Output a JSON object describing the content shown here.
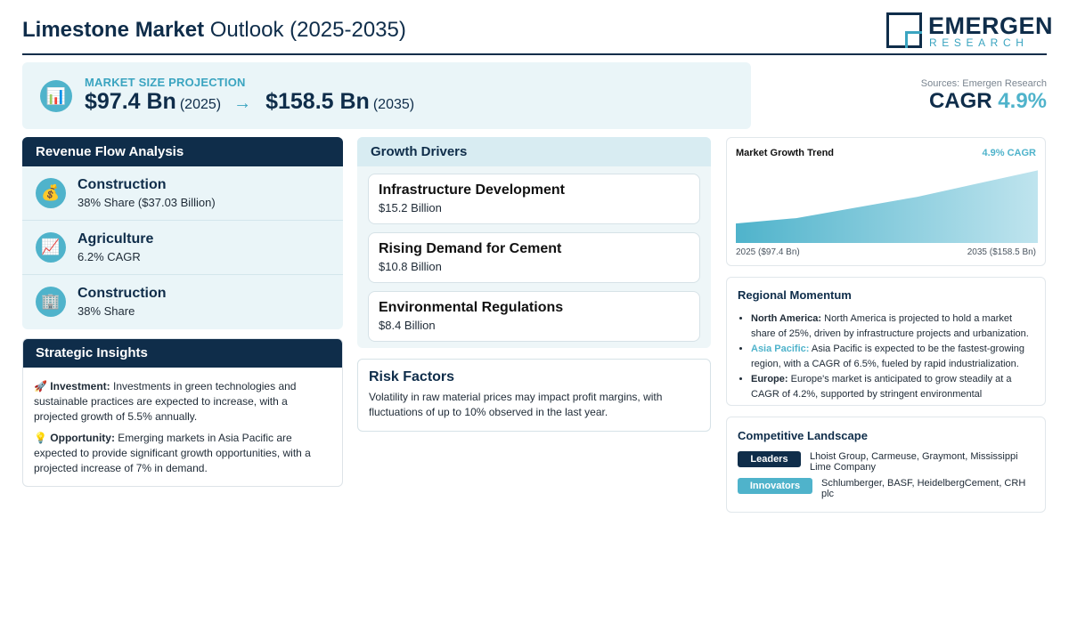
{
  "header": {
    "title_bold": "Limestone Market",
    "title_rest": "Outlook (2025-2035)",
    "logo_word": "EMERGEN",
    "logo_sub": "RESEARCH"
  },
  "projection": {
    "label": "MARKET SIZE PROJECTION",
    "icon": "bar-chart-icon",
    "start_value": "$97.4 Bn",
    "start_year": "(2025)",
    "arrow": "→",
    "end_value": "$158.5 Bn",
    "end_year": "(2035)"
  },
  "sources": "Sources: Emergen Research",
  "cagr": {
    "label": "CAGR",
    "value": "4.9%"
  },
  "revenue_flow": {
    "title": "Revenue Flow Analysis",
    "items": [
      {
        "icon": "money-bag-icon",
        "glyph": "💰",
        "title": "Construction",
        "sub": "38% Share ($37.03 Billion)"
      },
      {
        "icon": "chart-up-icon",
        "glyph": "📈",
        "title": "Agriculture",
        "sub": "6.2% CAGR"
      },
      {
        "icon": "building-icon",
        "glyph": "🏢",
        "title": "Construction",
        "sub": "38% Share"
      }
    ]
  },
  "strategic": {
    "title": "Strategic Insights",
    "items": [
      {
        "icon": "rocket-icon",
        "glyph": "🚀",
        "label": "Investment:",
        "text": "Investments in green technologies and sustainable practices are expected to increase, with a projected growth of 5.5% annually."
      },
      {
        "icon": "lightbulb-icon",
        "glyph": "💡",
        "label": "Opportunity:",
        "text": "Emerging markets in Asia Pacific are expected to provide significant growth opportunities, with a projected increase of 7% in demand."
      }
    ]
  },
  "drivers": {
    "title": "Growth Drivers",
    "items": [
      {
        "title": "Infrastructure Development",
        "value": "$15.2 Billion"
      },
      {
        "title": "Rising Demand for Cement",
        "value": "$10.8 Billion"
      },
      {
        "title": "Environmental Regulations",
        "value": "$8.4 Billion"
      }
    ]
  },
  "risk": {
    "title": "Risk Factors",
    "text": "Volatility in raw material prices may impact profit margins, with fluctuations of up to 10% observed in the last year."
  },
  "trend": {
    "title": "Market Growth Trend",
    "cagr_label": "4.9% CAGR",
    "x_start_label": "2025 ($97.4 Bn)",
    "x_end_label": "2035 ($158.5 Bn)"
  },
  "chart_data": {
    "type": "area",
    "title": "Market Growth Trend",
    "x": [
      2025,
      2027,
      2029,
      2031,
      2033,
      2035
    ],
    "values": [
      97.4,
      103.5,
      115.8,
      128.0,
      143.3,
      158.5
    ],
    "unit": "$ Bn",
    "grid": false,
    "color": "#4fb3cb"
  },
  "regional": {
    "title": "Regional Momentum",
    "items": [
      {
        "label": "North America:",
        "accent": false,
        "text": "North America is projected to hold a market share of 25%, driven by infrastructure projects and urbanization."
      },
      {
        "label": "Asia Pacific:",
        "accent": true,
        "text": "Asia Pacific is expected to be the fastest-growing region, with a CAGR of 6.5%, fueled by rapid industrialization."
      },
      {
        "label": "Europe:",
        "accent": false,
        "text": "Europe's market is anticipated to grow steadily at a CAGR of 4.2%, supported by stringent environmental regulations."
      }
    ]
  },
  "competitive": {
    "title": "Competitive Landscape",
    "leaders_label": "Leaders",
    "leaders_text": "Lhoist Group, Carmeuse, Graymont, Mississippi Lime Company",
    "innovators_label": "Innovators",
    "innovators_text": "Schlumberger, BASF, HeidelbergCement, CRH plc"
  },
  "colors": {
    "navy": "#0f2d4a",
    "teal": "#4fb3cb",
    "light_panel": "#eaf5f8"
  }
}
